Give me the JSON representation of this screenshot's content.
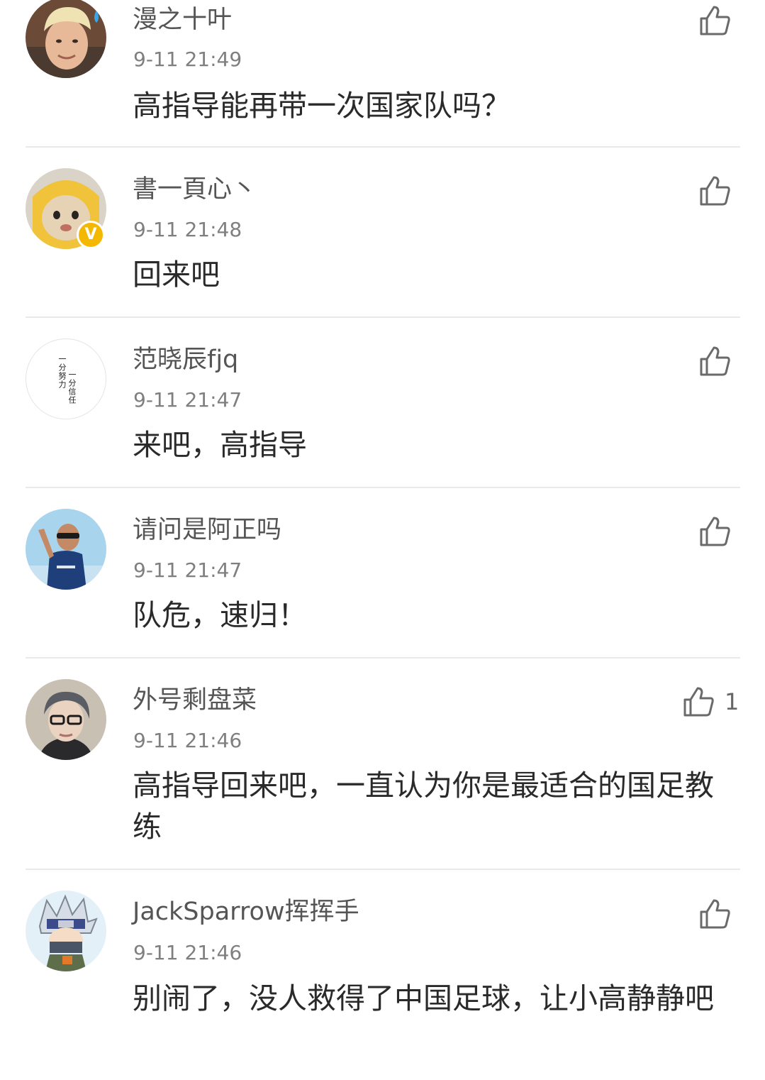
{
  "comments": [
    {
      "username": "漫之十叶",
      "timestamp": "9-11 21:49",
      "text": "高指导能再带一次国家队吗？",
      "likes": "",
      "avatar_icon": "user-avatar-blond-boy"
    },
    {
      "username": "書一頁心丶",
      "timestamp": "9-11 21:48",
      "text": "回来吧",
      "likes": "",
      "avatar_icon": "user-avatar-dog-in-hoodie",
      "badge": "V"
    },
    {
      "username": "范晓辰fjq",
      "timestamp": "9-11 21:47",
      "text": "来吧，高指导",
      "likes": "",
      "avatar_icon": "user-avatar-calligraphy-motto",
      "avatar_text": [
        "一分努力",
        "一分信任"
      ]
    },
    {
      "username": "请问是阿正吗",
      "timestamp": "9-11 21:47",
      "text": "队危，速归！",
      "likes": "",
      "avatar_icon": "user-avatar-man-sunglasses"
    },
    {
      "username": "外号剩盘菜",
      "timestamp": "9-11 21:46",
      "text": "高指导回来吧，一直认为你是最适合的国足教练",
      "likes": "1",
      "avatar_icon": "user-avatar-man-glasses"
    },
    {
      "username": "JackSparrow挥挥手",
      "timestamp": "9-11 21:46",
      "text": "别闹了，没人救得了中国足球，让小高静静吧",
      "likes": "",
      "avatar_icon": "user-avatar-anime-ninja"
    }
  ],
  "colors": {
    "username": "#555555",
    "timestamp": "#7f7f7f",
    "text": "#2a2a2a",
    "divider": "#e9e9e9",
    "like_icon": "#6a6a6a",
    "verified_badge": "#f5b800"
  },
  "icons": {
    "like": "thumbs-up-icon"
  }
}
